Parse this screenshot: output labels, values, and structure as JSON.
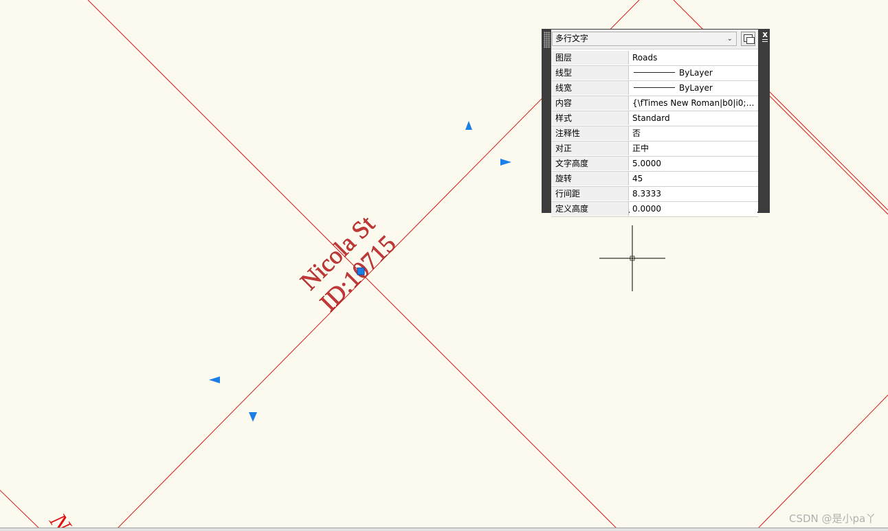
{
  "drawing": {
    "road_label_name": "Nicola St",
    "road_label_id": "ID:10715",
    "edge_label_fragment": "N",
    "colors": {
      "background": "#fcfaee",
      "road_line": "#d11a1a",
      "road_text": "#c43a3a",
      "grip": "#1a7fe6"
    }
  },
  "palette": {
    "object_type": "多行文字",
    "close_label": "x",
    "properties": [
      {
        "label": "图层",
        "value": "Roads"
      },
      {
        "label": "线型",
        "value": "ByLayer"
      },
      {
        "label": "线宽",
        "value": "ByLayer"
      },
      {
        "label": "内容",
        "value": "{\\fTimes New Roman|b0|i0;Ni..."
      },
      {
        "label": "样式",
        "value": "Standard"
      },
      {
        "label": "注释性",
        "value": "否"
      },
      {
        "label": "对正",
        "value": "正中"
      },
      {
        "label": "文字高度",
        "value": "5.0000"
      },
      {
        "label": "旋转",
        "value": "45"
      },
      {
        "label": "行间距",
        "value": "8.3333"
      },
      {
        "label": "定义高度",
        "value": "0.0000"
      }
    ]
  },
  "watermark": "CSDN @是小pa丫",
  "icons": {
    "grip_arrow": "triangle-grip-icon",
    "grip_square": "square-grip-icon",
    "crosshair": "crosshair-cursor-icon",
    "quick_select": "quick-select-icon",
    "dropdown": "chevron-down-icon",
    "close": "close-icon",
    "menu": "palette-menu-icon"
  }
}
